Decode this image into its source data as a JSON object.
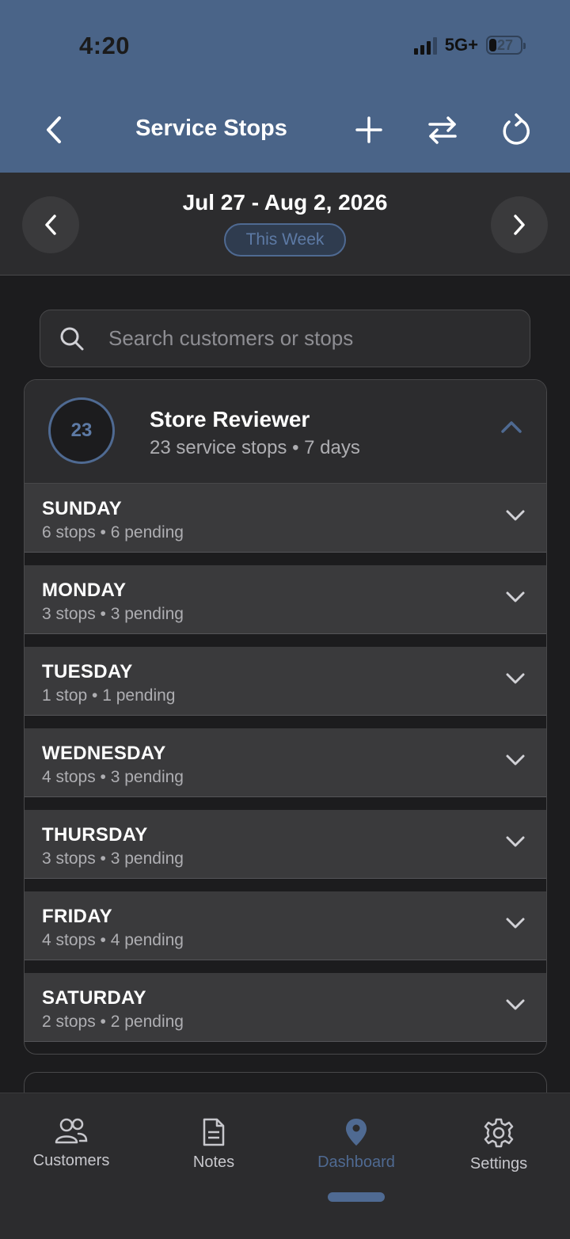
{
  "status": {
    "time": "4:20",
    "network": "5G+",
    "battery": "27"
  },
  "nav": {
    "title": "Service Stops"
  },
  "week": {
    "range": "Jul 27 - Aug 2, 2026",
    "badge": "This Week"
  },
  "search": {
    "placeholder": "Search customers or stops"
  },
  "group": {
    "count": "23",
    "name": "Store Reviewer",
    "summary": "23 service stops • 7 days",
    "days": [
      {
        "name": "SUNDAY",
        "summary": "6 stops • 6 pending"
      },
      {
        "name": "MONDAY",
        "summary": "3 stops • 3 pending"
      },
      {
        "name": "TUESDAY",
        "summary": "1 stop • 1 pending"
      },
      {
        "name": "WEDNESDAY",
        "summary": "4 stops • 3 pending"
      },
      {
        "name": "THURSDAY",
        "summary": "3 stops • 3 pending"
      },
      {
        "name": "FRIDAY",
        "summary": "4 stops • 4 pending"
      },
      {
        "name": "SATURDAY",
        "summary": "2 stops • 2 pending"
      }
    ]
  },
  "tabs": [
    {
      "label": "Customers",
      "icon": "people-icon"
    },
    {
      "label": "Notes",
      "icon": "document-icon"
    },
    {
      "label": "Dashboard",
      "icon": "location-pin-icon",
      "active": true
    },
    {
      "label": "Settings",
      "icon": "gear-icon"
    }
  ],
  "colors": {
    "header": "#4a6488",
    "accent": "#4f6a92",
    "background": "#1c1c1e"
  }
}
